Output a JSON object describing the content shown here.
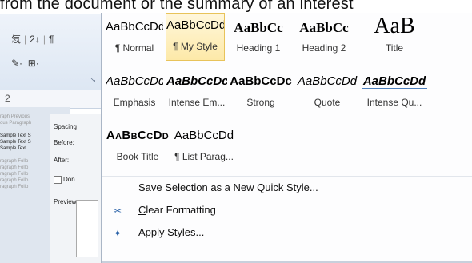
{
  "doc_strip": {
    "text": "from the document or the summary of an interest"
  },
  "ribbon": {
    "row1": {
      "a": "忥",
      "b": "2↓",
      "c": "¶"
    },
    "row2": {
      "a": "✎·",
      "b": "⊞·"
    },
    "expander": "↘"
  },
  "ruler": {
    "mark": "2"
  },
  "left_panel": {
    "lines": [
      "raph Previous",
      "ous Paragraph",
      "Sample Text S",
      "Sample Text S",
      "Sample Text",
      "ragraph Follo",
      "ragraph Follo",
      "ragraph Follo",
      "ragraph Follo",
      "ragraph Follo"
    ],
    "icon1": "∷",
    "icon2": "¶"
  },
  "dialog": {
    "spacing": "Spacing",
    "before": "Before:",
    "after": "After:",
    "dont": "Don",
    "preview": "Preview"
  },
  "gallery": {
    "row1": [
      {
        "sample": "AaBbCcDd",
        "name": "¶ Normal",
        "selected": false
      },
      {
        "sample": "AaBbCcDd",
        "name": "¶ My Style",
        "selected": true
      },
      {
        "sample": "AaBbCc",
        "name": "Heading 1",
        "selected": false
      },
      {
        "sample": "AaBbCc",
        "name": "Heading 2",
        "selected": false
      },
      {
        "sample": "AaB",
        "name": "Title",
        "selected": false
      }
    ],
    "row2": [
      {
        "sample": "AaBbCcDd",
        "name": "Emphasis"
      },
      {
        "sample": "AaBbCcDc",
        "name": "Intense Em..."
      },
      {
        "sample": "AaBbCcDc",
        "name": "Strong"
      },
      {
        "sample": "AaBbCcDd",
        "name": "Quote"
      },
      {
        "sample": "AaBbCcDd",
        "name": "Intense Qu..."
      }
    ],
    "row3": [
      {
        "sample": "AaBbCcDd",
        "name": "Book Title"
      },
      {
        "sample": "AaBbCcDd",
        "name": "¶ List Parag..."
      }
    ]
  },
  "menu": {
    "save": {
      "label": "Save Selection as a New Quick Style..."
    },
    "clear": {
      "label_u": "C",
      "label_rest": "lear Formatting",
      "icon": "✂"
    },
    "apply": {
      "label_u": "A",
      "label_rest": "pply Styles...",
      "icon": "✦"
    }
  },
  "colors": {
    "selected_border": "#e8c35a",
    "heading1": "#1f497d",
    "heading2": "#4f81bd",
    "accent_blue": "#4f81bd"
  }
}
